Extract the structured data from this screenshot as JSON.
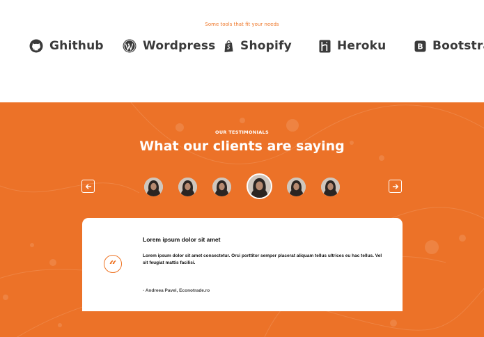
{
  "tools": {
    "caption": "Some tools that fit your needs",
    "logos": [
      {
        "name": "Ghithub",
        "icon": "github-icon"
      },
      {
        "name": "Wordpress",
        "icon": "wordpress-icon"
      },
      {
        "name": "Shopify",
        "icon": "shopify-icon"
      },
      {
        "name": "Heroku",
        "icon": "heroku-icon"
      },
      {
        "name": "Bootstra",
        "icon": "bootstrap-icon"
      }
    ]
  },
  "testimonials": {
    "eyebrow": "OUR TESTIMONIALS",
    "heading": "What our clients are saying",
    "prev_icon": "arrow-left-icon",
    "next_icon": "arrow-right-icon",
    "avatars_count": 6,
    "active_avatar": 4,
    "card": {
      "quote_glyph": "“",
      "title": "Lorem ipsum dolor sit amet",
      "text": "Lorem ipsum dolor sit amet consectetur. Orci porttitor semper placerat aliquam tellus ultrices eu hac tellus. Vel sit feugiat mattis facilisi.",
      "author": "- Andreea Pavel, Econotrade.ro"
    }
  },
  "colors": {
    "accent": "#ee7424",
    "section_bg": "#ec7228",
    "logo_text": "#3a3a3a"
  }
}
